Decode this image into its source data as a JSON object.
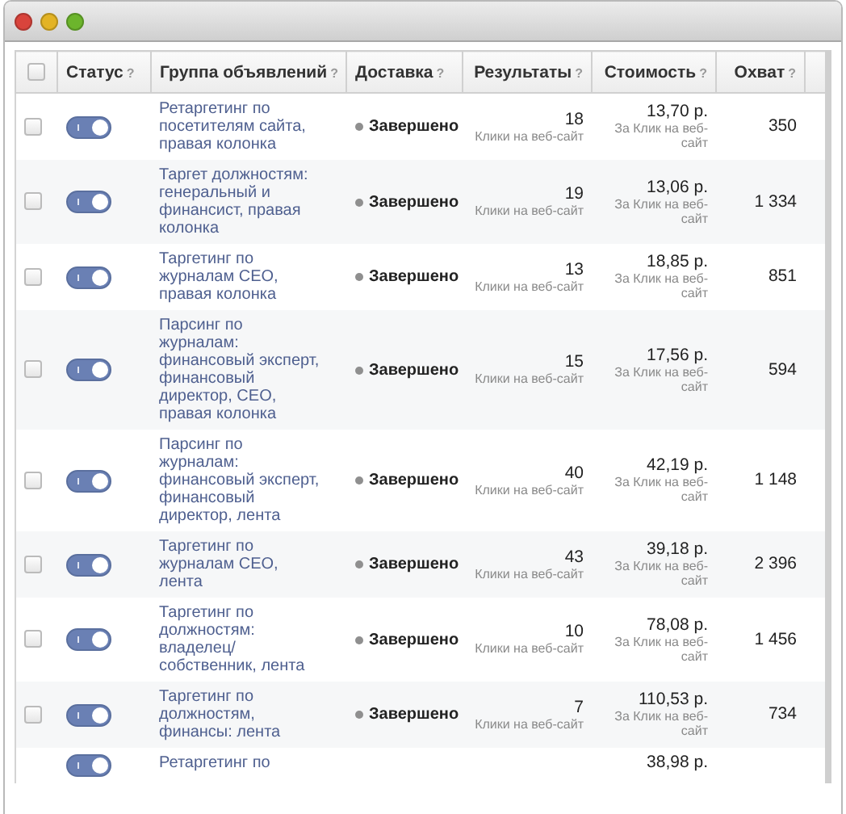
{
  "window": {
    "buttons": [
      {
        "color": "#d9443c"
      },
      {
        "color": "#e3b324"
      },
      {
        "color": "#6cb52c"
      }
    ]
  },
  "table": {
    "select_all": {
      "checked": false
    },
    "columns": [
      {
        "label": "Статус",
        "help": "?"
      },
      {
        "label": "Группа объявлений",
        "help": "?"
      },
      {
        "label": "Доставка",
        "help": "?"
      },
      {
        "label": "Результаты",
        "help": "?"
      },
      {
        "label": "Стоимость",
        "help": "?"
      },
      {
        "label": "Охват",
        "help": "?"
      }
    ],
    "rows": [
      {
        "checked": false,
        "on": true,
        "group": "Ретаргетинг по посетителям сайта, правая колонка",
        "delivery": "Завершено",
        "results": "18",
        "results_label": "Клики на веб-сайт",
        "cost": "13,70 р.",
        "cost_label": "За Клик на веб-сайт",
        "reach": "350"
      },
      {
        "checked": false,
        "on": true,
        "group": "Таргет должностям: генеральный и финансист, правая колонка",
        "delivery": "Завершено",
        "results": "19",
        "results_label": "Клики на веб-сайт",
        "cost": "13,06 р.",
        "cost_label": "За Клик на веб-сайт",
        "reach": "1 334"
      },
      {
        "checked": false,
        "on": true,
        "group": "Таргетинг по журналам CEO, правая колонка",
        "delivery": "Завершено",
        "results": "13",
        "results_label": "Клики на веб-сайт",
        "cost": "18,85 р.",
        "cost_label": "За Клик на веб-сайт",
        "reach": "851"
      },
      {
        "checked": false,
        "on": true,
        "group": "Парсинг по журналам: финансовый эксперт, финансовый директор, CEO, правая колонка",
        "delivery": "Завершено",
        "results": "15",
        "results_label": "Клики на веб-сайт",
        "cost": "17,56 р.",
        "cost_label": "За Клик на веб-сайт",
        "reach": "594"
      },
      {
        "checked": false,
        "on": true,
        "group": "Парсинг по журналам: финансовый эксперт, финансовый директор, лента",
        "delivery": "Завершено",
        "results": "40",
        "results_label": "Клики на веб-сайт",
        "cost": "42,19 р.",
        "cost_label": "За Клик на веб-сайт",
        "reach": "1 148"
      },
      {
        "checked": false,
        "on": true,
        "group": "Таргетинг по журналам CEO, лента",
        "delivery": "Завершено",
        "results": "43",
        "results_label": "Клики на веб-сайт",
        "cost": "39,18 р.",
        "cost_label": "За Клик на веб-сайт",
        "reach": "2 396"
      },
      {
        "checked": false,
        "on": true,
        "group": "Таргетинг по должностям: владелец/ собственник, лента",
        "delivery": "Завершено",
        "results": "10",
        "results_label": "Клики на веб-сайт",
        "cost": "78,08 р.",
        "cost_label": "За Клик на веб-сайт",
        "reach": "1 456"
      },
      {
        "checked": false,
        "on": true,
        "group": "Таргетинг по должностям, финансы: лента",
        "delivery": "Завершено",
        "results": "7",
        "results_label": "Клики на веб-сайт",
        "cost": "110,53 р.",
        "cost_label": "За Клик на веб-сайт",
        "reach": "734"
      },
      {
        "on": true,
        "group": "Ретаргетинг по",
        "cost": "38,98 р."
      }
    ]
  }
}
